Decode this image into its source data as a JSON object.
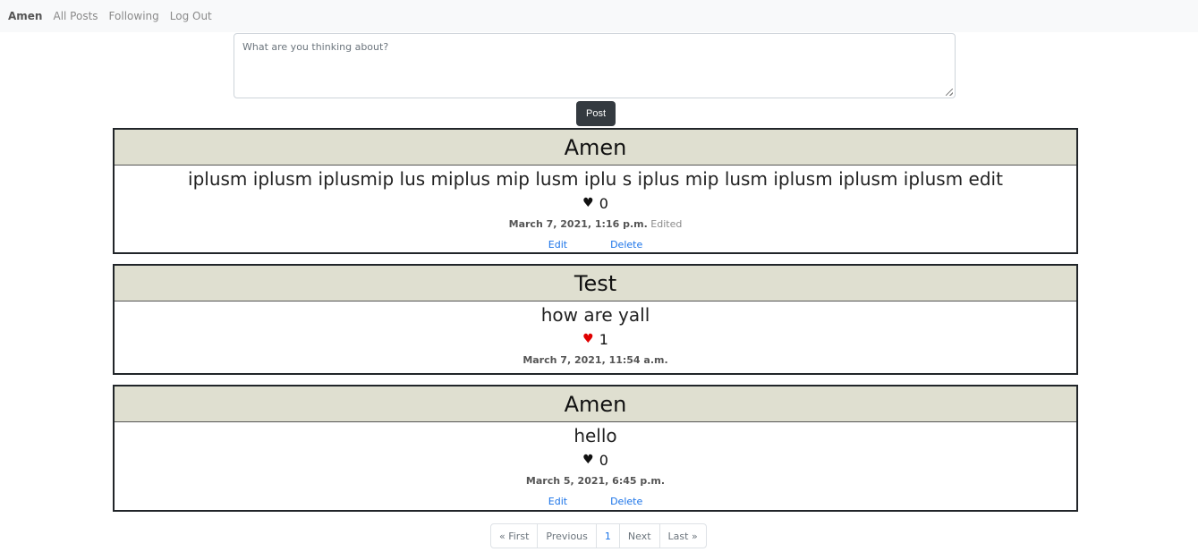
{
  "nav": {
    "brand": "Amen",
    "links": [
      "All Posts",
      "Following",
      "Log Out"
    ]
  },
  "compose": {
    "placeholder": "What are you thinking about?",
    "button": "Post"
  },
  "posts": [
    {
      "author": "Amen",
      "content": "iplusm iplusm iplusmip lus miplus mip lusm iplu s iplus mip lusm iplusm iplusm iplusm edit",
      "likes": "0",
      "liked": false,
      "timestamp": "March 7, 2021, 1:16 p.m.",
      "edited": "Edited",
      "edit": "Edit",
      "delete": "Delete"
    },
    {
      "author": "Test",
      "content": "how are yall",
      "likes": "1",
      "liked": true,
      "timestamp": "March 7, 2021, 11:54 a.m."
    },
    {
      "author": "Amen",
      "content": "hello",
      "likes": "0",
      "liked": false,
      "timestamp": "March 5, 2021, 6:45 p.m.",
      "edit": "Edit",
      "delete": "Delete"
    }
  ],
  "pagination": [
    "« First",
    "Previous",
    "1",
    "Next",
    "Last »"
  ],
  "colors": {
    "header_bg": "#dfdfd0",
    "like_active": "#e00000",
    "link": "#1a73e8"
  },
  "icons": {
    "heart": "♥"
  }
}
